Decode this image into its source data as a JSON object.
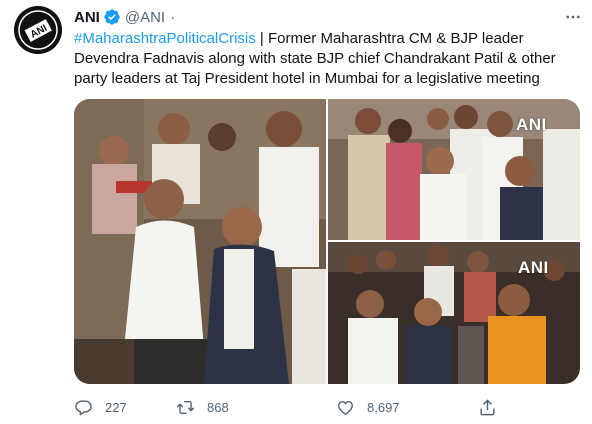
{
  "tweet": {
    "author_name": "ANI",
    "author_handle": "@ANI",
    "separator": "·",
    "avatar_text": "ANI",
    "hashtag": "#MaharashtraPoliticalCrisis",
    "text_line1_rest": " | Former Maharashtra CM & BJP leader",
    "text_line2": "Devendra Fadnavis along with state BJP chief Chandrakant Patil & other",
    "text_line3": "party leaders at Taj President hotel in Mumbai for a legislative meeting",
    "media": {
      "watermark_1": "ANI",
      "watermark_2": "ANI"
    },
    "stats": {
      "replies": "227",
      "retweets": "868",
      "likes": "8,697"
    }
  },
  "colors": {
    "link": "#1d9bf0",
    "text": "#0f1419",
    "muted": "#536471",
    "verified": "#1d9bf0"
  },
  "icons": {
    "verified": "verified-badge-icon",
    "more": "more-options-icon",
    "reply": "reply-icon",
    "retweet": "retweet-icon",
    "like": "heart-icon",
    "share": "share-icon"
  }
}
